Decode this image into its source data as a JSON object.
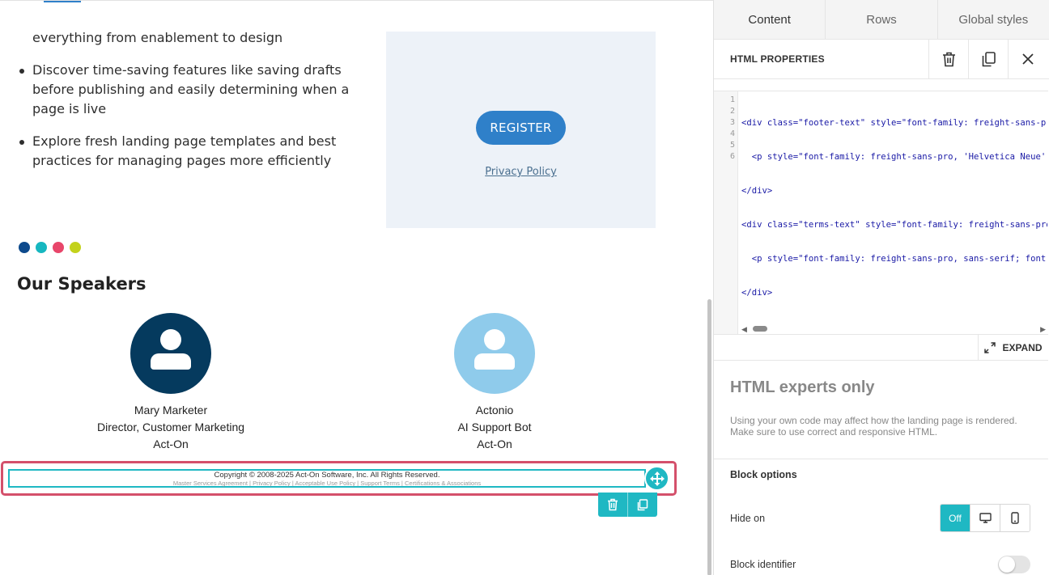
{
  "canvas": {
    "bullets": {
      "continuation": "everything from enablement to design",
      "items": [
        "Discover time-saving features like saving drafts before publishing and easily determining when a page is live",
        "Explore fresh landing page templates and best practices for managing pages more efficiently"
      ]
    },
    "register": {
      "button_label": "REGISTER",
      "privacy_link": "Privacy Policy"
    },
    "dots": [
      "#0d4a8c",
      "#17b7c0",
      "#e8466a",
      "#c3d21b"
    ],
    "speakers_title": "Our Speakers",
    "speakers": [
      {
        "name": "Mary Marketer",
        "title": "Director, Customer Marketing",
        "company": "Act-On",
        "avatar_color": "#053a5e"
      },
      {
        "name": "Actonio",
        "title": "AI Support Bot",
        "company": "Act-On",
        "avatar_color": "#8fcbeb"
      }
    ],
    "footer": {
      "copyright": "Copyright © 2008-2025 Act-On Software, Inc. All Rights Reserved.",
      "links": "Master Services Agreement | Privacy Policy | Acceptable Use Policy | Support Terms | Certifications & Associations"
    }
  },
  "panel": {
    "tabs": [
      {
        "label": "Content",
        "active": true
      },
      {
        "label": "Rows",
        "active": false
      },
      {
        "label": "Global styles",
        "active": false
      }
    ],
    "props_title": "HTML PROPERTIES",
    "code_lines": [
      "<div class=\"footer-text\" style=\"font-family: freight-sans-pro",
      "  <p style=\"font-family: freight-sans-pro, 'Helvetica Neue',",
      "</div>",
      "<div class=\"terms-text\" style=\"font-family: freight-sans-pro",
      "  <p style=\"font-family: freight-sans-pro, sans-serif; font-",
      "</div>"
    ],
    "line_numbers": [
      "1",
      "2",
      "3",
      "4",
      "5",
      "6"
    ],
    "expand_label": "EXPAND",
    "experts_title": "HTML experts only",
    "experts_text": "Using your own code may affect how the landing page is rendered. Make sure to use correct and responsive HTML.",
    "block_options_title": "Block options",
    "hide_on_label": "Hide on",
    "hide_on_off": "Off",
    "block_identifier_label": "Block identifier",
    "accent_color": "#1fb8c3"
  }
}
